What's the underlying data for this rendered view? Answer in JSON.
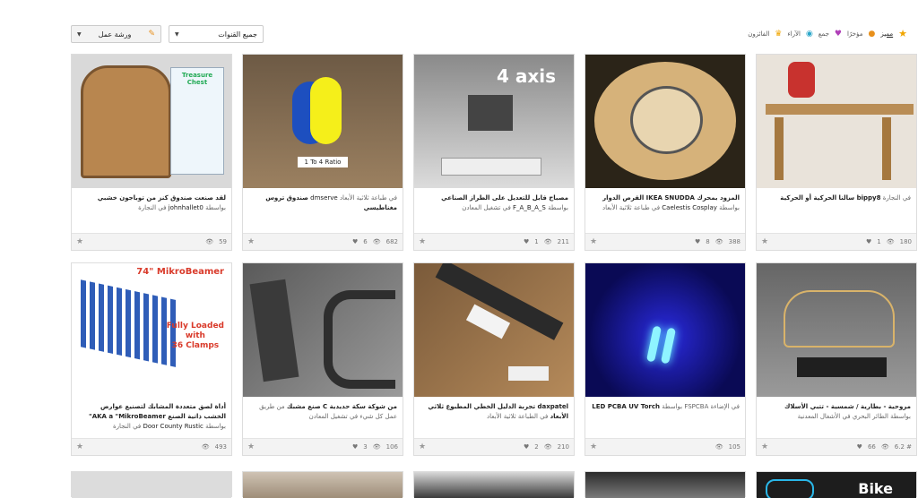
{
  "filters": {
    "workshop": "ورشة عمل",
    "channels": "جميع القنوات"
  },
  "nav": {
    "featured": "مميز",
    "recent": "مؤخرًا",
    "popular": "جمع",
    "views": "الآراء",
    "winners": "الفائزون"
  },
  "cards": [
    {
      "title": "لقد صنعت صندوق كنز من توباجون خشبي",
      "by": "بواسطة",
      "author": "johnhallet0",
      "category": "في النجارة",
      "likes": "",
      "views": "59",
      "thumb_text": "Treasure Chest"
    },
    {
      "title": "صندوق تروس مغناطيسي",
      "by": "dmserve",
      "author": "",
      "category": "في طباعة ثلاثية الأبعاد",
      "likes": "6",
      "views": "682",
      "thumb_text": "1 To 4  Ratio"
    },
    {
      "title": "مصباح قابل للتعديل على الطراز الصناعي",
      "by": "بواسطة",
      "author": "F_A_B_A_S",
      "category": "في تشغيل المعادن",
      "likes": "1",
      "views": "211",
      "thumb_text": "4 axis"
    },
    {
      "title": "المزود بمحرك IKEA SNUDDA القرص الدوار",
      "by": "بواسطة",
      "author": "Caelestis Cosplay",
      "category": "في طباعة ثلاثية الأبعاد",
      "likes": "8",
      "views": "388",
      "thumb_text": ""
    },
    {
      "title": "bippy8 سالنا الحركية أو الحركية",
      "by": "بواسطة",
      "author": "",
      "category": "في النجارة",
      "likes": "1",
      "views": "180",
      "thumb_text": ""
    },
    {
      "title": "أداة لصق متعددة المشابك لتصنيع عوارض الخشب ذاتية الصنع AKA a \"MikroBeamer\"",
      "by": "بواسطة",
      "author": "Door County Rustic",
      "category": "في النجارة",
      "likes": "",
      "views": "493",
      "thumb_text": "74\" MikroBeamer"
    },
    {
      "title": "من شوكة سكة حديدية C صنع مشبك",
      "by": "من طريق عمل كل شيء",
      "author": "",
      "category": "في تشغيل المعادن",
      "likes": "3",
      "views": "106",
      "thumb_text": ""
    },
    {
      "title": "daxpatel تجربة الدليل الخطي المطبوع ثلاثي الأبعاد",
      "by": "بواسطة",
      "author": "",
      "category": "في الطباعة ثلاثية الأبعاد",
      "likes": "2",
      "views": "210",
      "thumb_text": ""
    },
    {
      "title": "LED PCBA UV Torch",
      "by": "FSPCBA بواسطة",
      "author": "",
      "category": "في الإضاءة",
      "likes": "",
      "views": "105",
      "thumb_text": ""
    },
    {
      "title": "مروحية - بطارية / شمسية - تتبي الأسلاك",
      "by": "بواسطة الطائر",
      "author": "",
      "category": "البحري في الأشغال المعدنية",
      "likes": "66",
      "views": "6.2 #",
      "thumb_text": ""
    }
  ],
  "row3": {
    "bike_text": "Bike"
  },
  "colors": {
    "star": "#f0a500",
    "pencil": "#e8901b"
  }
}
